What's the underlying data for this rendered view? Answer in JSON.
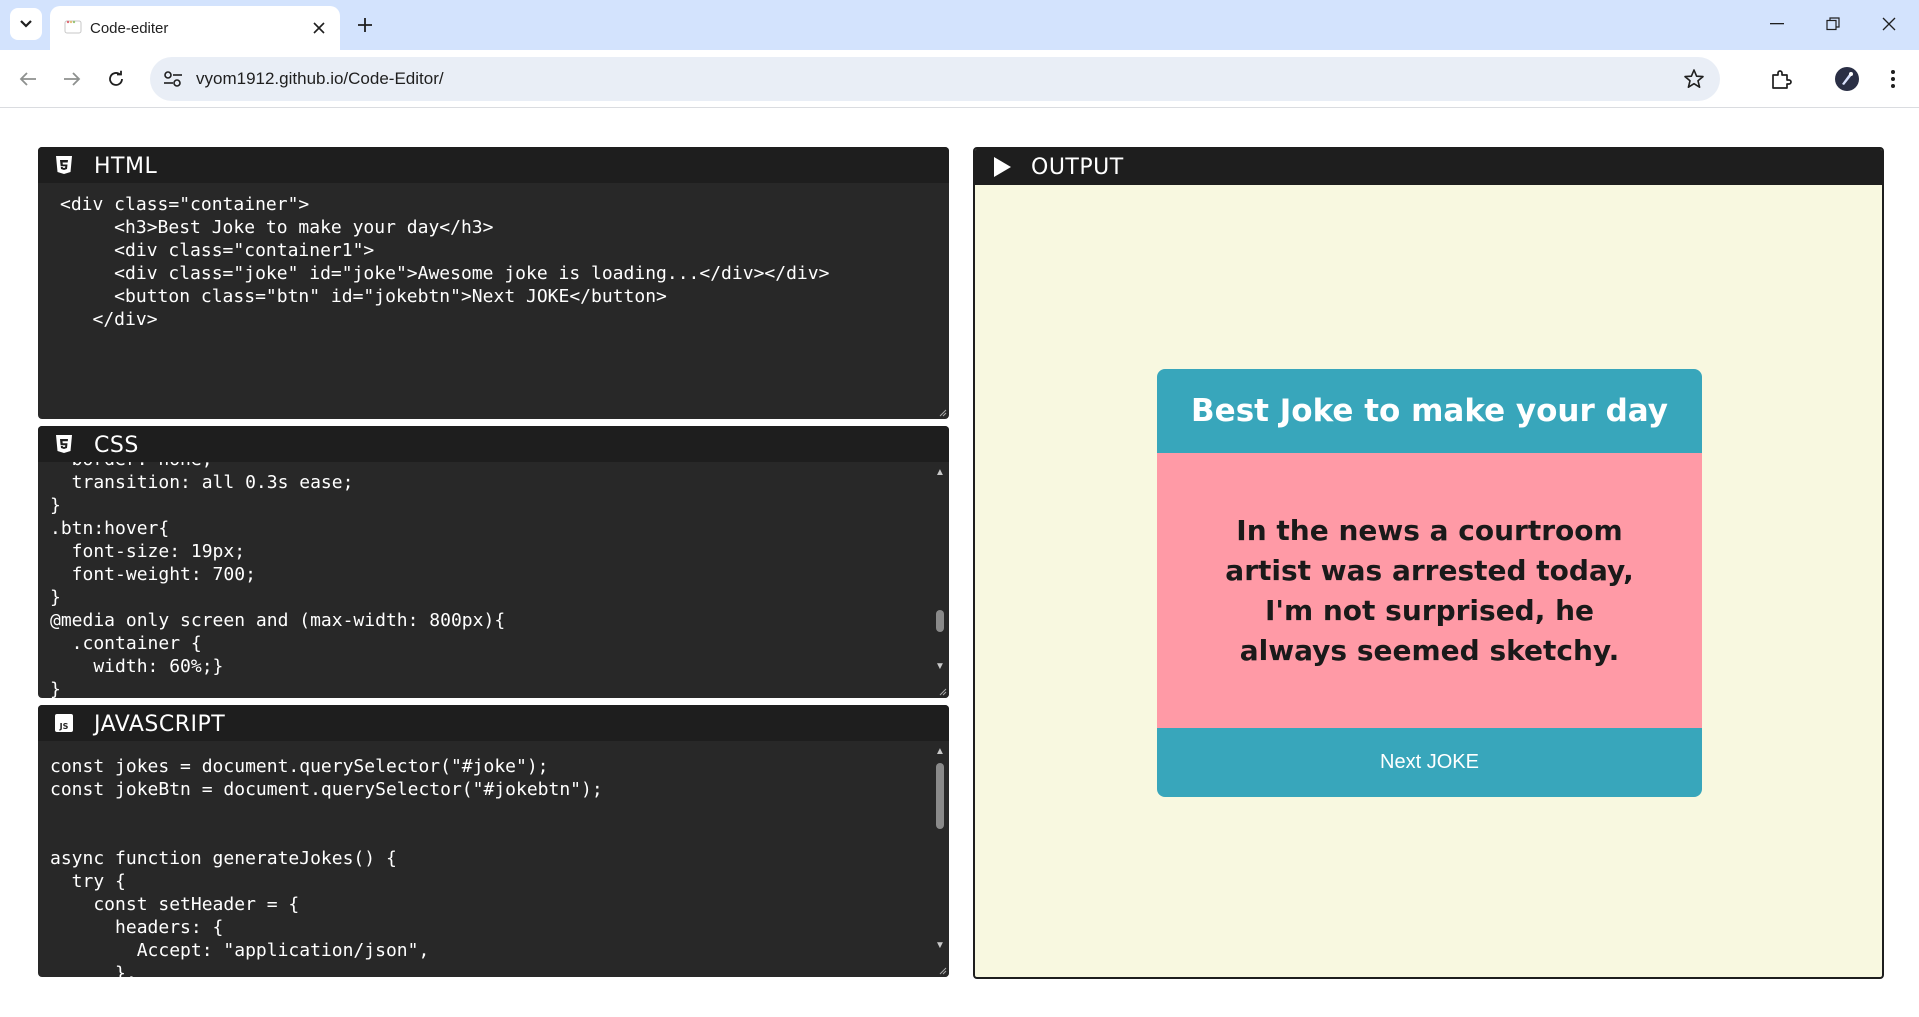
{
  "browser": {
    "tab_title": "Code-editer",
    "url": "vyom1912.github.io/Code-Editor/"
  },
  "panels": {
    "html": {
      "label": "HTML",
      "lines": [
        "<div class=\"container\">",
        "     <h3>Best Joke to make your day</h3>",
        "     <div class=\"container1\">",
        "     <div class=\"joke\" id=\"joke\">Awesome joke is loading...</div></div>",
        "     <button class=\"btn\" id=\"jokebtn\">Next JOKE</button>",
        "   </div>"
      ]
    },
    "css": {
      "label": "CSS",
      "lines": [
        "  border: none;",
        "  transition: all 0.3s ease;",
        "}",
        ".btn:hover{",
        "  font-size: 19px;",
        "  font-weight: 700;",
        "}",
        "@media only screen and (max-width: 800px){",
        "  .container {",
        "    width: 60%;}",
        "}"
      ]
    },
    "javascript": {
      "label": "JAVASCRIPT",
      "lines": [
        "const jokes = document.querySelector(\"#joke\");",
        "const jokeBtn = document.querySelector(\"#jokebtn\");",
        "",
        "",
        "async function generateJokes() {",
        "  try {",
        "    const setHeader = {",
        "      headers: {",
        "        Accept: \"application/json\",",
        "      },"
      ]
    },
    "output": {
      "label": "OUTPUT",
      "joke_title": "Best Joke to make your day",
      "joke_text": "In the news a courtroom artist was arrested today, I'm not surprised, he always seemed sketchy.",
      "button_label": "Next JOKE"
    }
  },
  "colors": {
    "editor_bg": "#282828",
    "header_bg": "#1e1e1e",
    "output_bg": "#f8f8e0",
    "joke_teal": "#38a6bb",
    "joke_pink": "#ff9aa6"
  }
}
